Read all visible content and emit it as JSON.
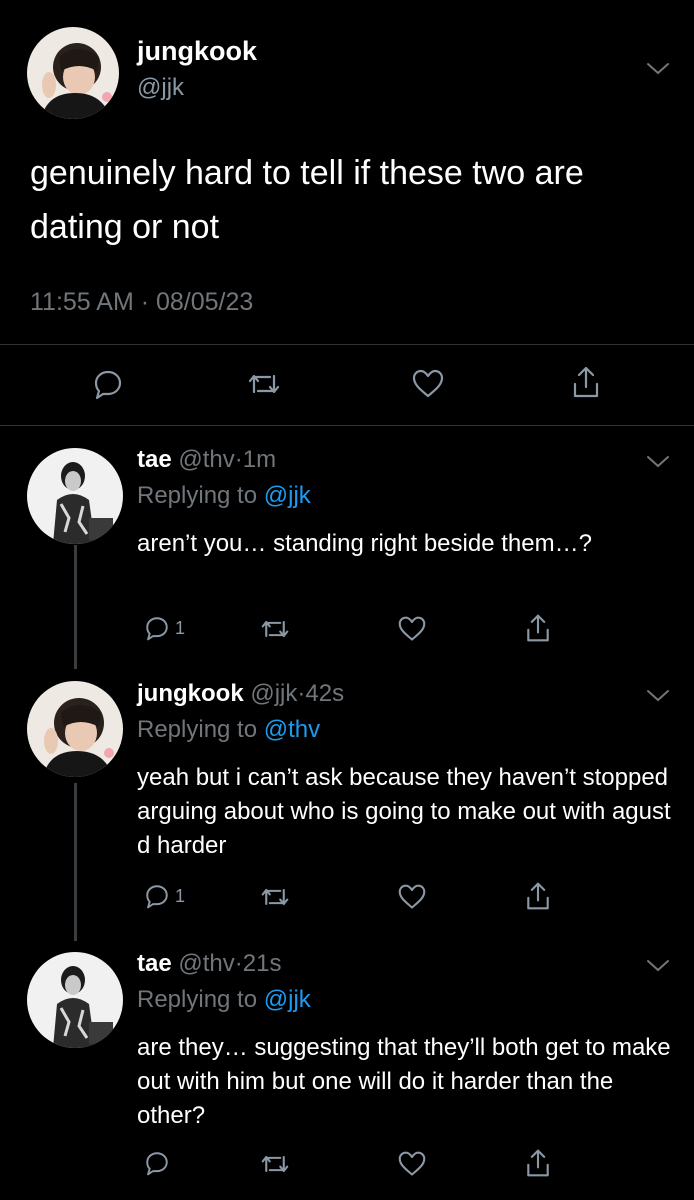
{
  "main_tweet": {
    "author_name": "jungkook",
    "author_handle": "@jjk",
    "text": "genuinely hard to tell if these two are dating or not",
    "timestamp": "11:55 AM · 08/05/23",
    "actions": [
      "reply-icon",
      "retweet-icon",
      "like-icon",
      "share-icon"
    ]
  },
  "replies": [
    {
      "author_name": "tae",
      "author_handle": "@thv",
      "separator": "·",
      "time": "1m",
      "replying_prefix": "Replying to",
      "replying_to": "@jjk",
      "text": "aren’t you… standing right beside them…?",
      "reply_count": "1"
    },
    {
      "author_name": "jungkook",
      "author_handle": "@jjk",
      "separator": "·",
      "time": "42s",
      "replying_prefix": "Replying to",
      "replying_to": "@thv",
      "text": "yeah but i can’t ask because they haven’t stopped arguing about who is going to make out with agust d harder",
      "reply_count": "1"
    },
    {
      "author_name": "tae",
      "author_handle": "@thv",
      "separator": "·",
      "time": "21s",
      "replying_prefix": "Replying to",
      "replying_to": "@jjk",
      "text": "are they… suggesting that they’ll both get to make out with him but one will do it harder than the other?",
      "reply_count": ""
    }
  ],
  "colors": {
    "background": "#000000",
    "text_primary": "#ffffff",
    "text_secondary": "#71767b",
    "link": "#1d9bf0",
    "divider": "#2f3336"
  }
}
